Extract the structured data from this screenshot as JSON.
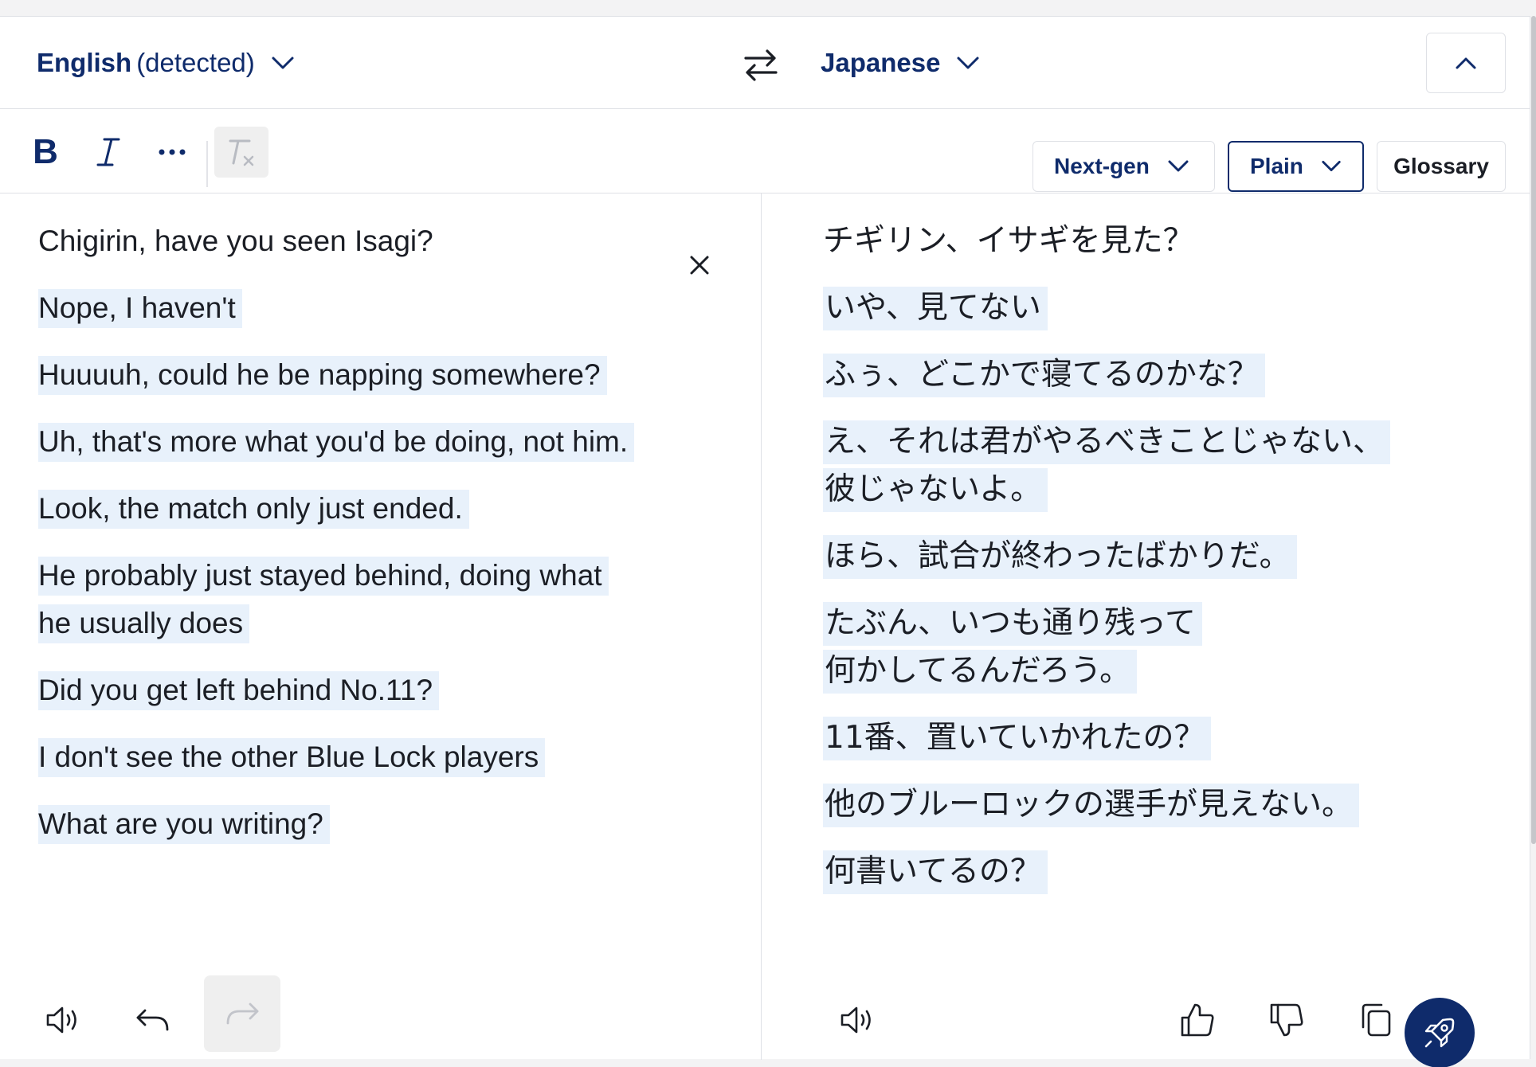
{
  "language_bar": {
    "source_language": "English",
    "source_suffix": "(detected)",
    "target_language": "Japanese"
  },
  "toolbar": {
    "bold_label": "B",
    "model_dropdown": "Next-gen",
    "style_dropdown": "Plain",
    "glossary_label": "Glossary"
  },
  "source": {
    "segments": [
      {
        "text": "Chigirin, have you seen Isagi?",
        "highlighted": false
      },
      {
        "text": "Nope, I haven't",
        "highlighted": true
      },
      {
        "text": "Huuuuh, could he be napping somewhere?",
        "highlighted": true
      },
      {
        "text": "Uh, that's more what you'd be doing, not him.",
        "highlighted": true
      },
      {
        "text": "Look, the match only just ended.",
        "highlighted": true
      },
      {
        "text": "He probably just stayed behind, doing what",
        "highlighted": true
      },
      {
        "text": "he usually does",
        "highlighted": true
      },
      {
        "text": "Did you get left behind No.11?",
        "highlighted": true
      },
      {
        "text": "I don't see the other Blue Lock players",
        "highlighted": true
      },
      {
        "text": "What are you writing?",
        "highlighted": true
      }
    ]
  },
  "target": {
    "segments": [
      {
        "text": "チギリン、イサギを見た？",
        "highlighted": false
      },
      {
        "text": "いや、見てない",
        "highlighted": true
      },
      {
        "text": "ふぅ、どこかで寝てるのかな？",
        "highlighted": true
      },
      {
        "text": "え、それは君がやるべきことじゃない、",
        "highlighted": true
      },
      {
        "text": "彼じゃないよ。",
        "highlighted": true
      },
      {
        "text": "ほら、試合が終わったばかりだ。",
        "highlighted": true
      },
      {
        "text": "たぶん、いつも通り残って",
        "highlighted": true
      },
      {
        "text": "何かしてるんだろう。",
        "highlighted": true
      },
      {
        "text": "11番、置いていかれたの？",
        "highlighted": true
      },
      {
        "text": "他のブルーロックの選手が見えない。",
        "highlighted": true
      },
      {
        "text": "何書いてるの？",
        "highlighted": true
      }
    ]
  },
  "colors": {
    "brand": "#0f2b6b",
    "highlight": "#e8f1fb",
    "border": "#dfe1e6"
  },
  "icons": {
    "swap": "swap-arrows-icon",
    "collapse": "chevron-up-icon",
    "speaker": "speaker-icon",
    "undo": "undo-icon",
    "redo": "redo-icon",
    "thumbs_up": "thumbs-up-icon",
    "thumbs_down": "thumbs-down-icon",
    "copy": "copy-icon",
    "rocket": "rocket-icon"
  }
}
